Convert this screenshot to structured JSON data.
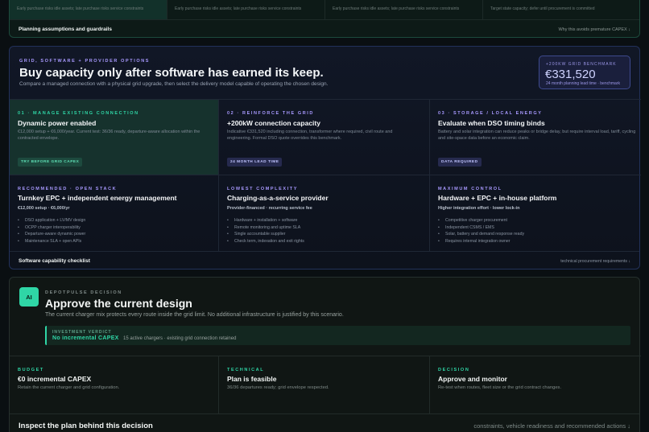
{
  "top": {
    "cells": [
      "Early purchase risks idle assets; late purchase risks service constraints",
      "Early purchase risks idle assets; late purchase risks service constraints",
      "Early purchase risks idle assets; late purchase risks service constraints",
      "Target state capacity; defer until procurement is committed"
    ],
    "footer_title": "Planning assumptions and guardrails",
    "footer_link": "Why this avoids premature CAPEX ↓"
  },
  "grid": {
    "eyebrow": "Grid, software + provider options",
    "title": "Buy capacity only after software has earned its keep.",
    "subtitle": "Compare a managed connection with a physical grid upgrade, then select the delivery model capable of operating the chosen design.",
    "benchmark": {
      "eyebrow": "+200kW grid benchmark",
      "value": "€331,520",
      "sub": "24 month planning lead time · benchmark"
    },
    "options": [
      {
        "eyebrow": "01 · Manage existing connection",
        "title": "Dynamic power enabled",
        "desc": "€12,000 setup + €6,000/year. Current test: 36/36 ready, departure-aware allocation within the contracted envelope.",
        "tag": "Try before grid CAPEX"
      },
      {
        "eyebrow": "02 · Reinforce the grid",
        "title": "+200kW connection capacity",
        "desc": "Indicative €331,520 including connection, transformer where required, civil route and engineering. Formal DSO quote overrides this benchmark.",
        "tag": "24 month lead time"
      },
      {
        "eyebrow": "03 · Storage / local energy",
        "title": "Evaluate when DSO timing binds",
        "desc": "Battery and solar integration can reduce peaks or bridge delay, but require interval load, tariff, cycling and site-space data before an economic claim.",
        "tag": "Data required"
      }
    ],
    "providers": [
      {
        "eyebrow": "Recommended · open stack",
        "title": "Turnkey EPC + independent energy management",
        "meta": "€12,000 setup · €6,000/yr",
        "items": [
          "DSO application + LV/MV design",
          "OCPP charger interoperability",
          "Departure-aware dynamic power",
          "Maintenance SLA + open APIs"
        ]
      },
      {
        "eyebrow": "Lowest complexity",
        "title": "Charging-as-a-service provider",
        "meta": "Provider-financed · recurring service fee",
        "items": [
          "Hardware + installation + software",
          "Remote monitoring and uptime SLA",
          "Single accountable supplier",
          "Check term, indexation and exit rights"
        ]
      },
      {
        "eyebrow": "Maximum control",
        "title": "Hardware + EPC + in-house platform",
        "meta": "Higher integration effort · lower lock-in",
        "items": [
          "Competitive charger procurement",
          "Independent CSMS / EMS",
          "Solar, battery and demand response ready",
          "Requires internal integration owner"
        ]
      }
    ],
    "footer_title": "Software capability checklist",
    "footer_link": "technical procurement requirements ↓"
  },
  "decision": {
    "badge": "AI",
    "eyebrow": "DepotPulse decision",
    "title": "Approve the current design",
    "subtitle": "The current charger mix protects every route inside the grid limit. No additional infrastructure is justified by this scenario.",
    "verdict": {
      "eyebrow": "Investment verdict",
      "value": "No incremental CAPEX",
      "note": "15 active chargers · existing grid connection retained"
    },
    "columns": [
      {
        "eyebrow": "Budget",
        "title": "€0 incremental CAPEX",
        "desc": "Retain the current charger and grid configuration."
      },
      {
        "eyebrow": "Technical",
        "title": "Plan is feasible",
        "desc": "36/36 departures ready; grid envelope respected."
      },
      {
        "eyebrow": "Decision",
        "title": "Approve and monitor",
        "desc": "Re-test when routes, fleet size or the grid contract changes."
      }
    ],
    "footer_title": "Inspect the plan behind this decision",
    "footer_link": "constraints, vehicle readiness and recommended actions ↓"
  },
  "colors": {
    "accent_green": "#2fd6a6",
    "accent_purple": "#a899ff",
    "background": "#0a0f12"
  }
}
